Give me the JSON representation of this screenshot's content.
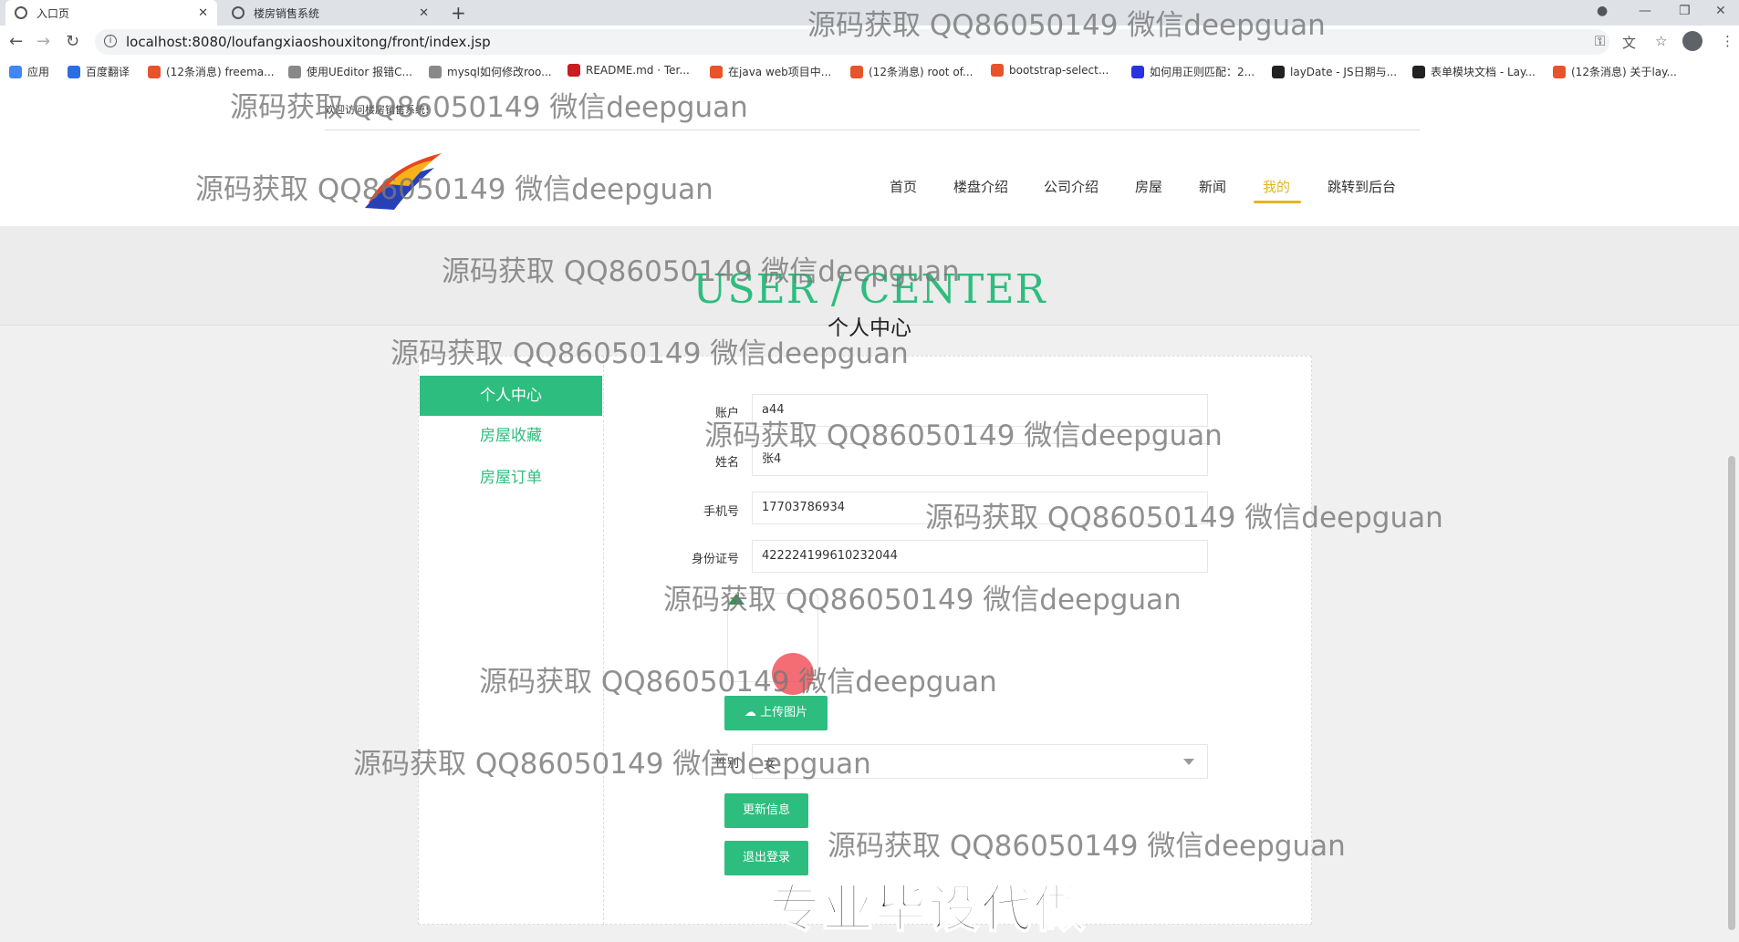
{
  "browser": {
    "tabs": [
      {
        "title": "入口页",
        "active": true
      },
      {
        "title": "楼房销售系统",
        "active": false
      }
    ],
    "url": "localhost:8080/loufangxiaoshouxitong/front/index.jsp",
    "bookmarks": [
      {
        "label": "应用",
        "color": "#4285f4"
      },
      {
        "label": "百度翻译",
        "color": "#2b6de5"
      },
      {
        "label": "(12条消息) freema...",
        "color": "#e8532b"
      },
      {
        "label": "使用UEditor 报错C...",
        "color": "#666666"
      },
      {
        "label": "mysql如何修改roo...",
        "color": "#666666"
      },
      {
        "label": "README.md · Ter...",
        "color": "#c71d23"
      },
      {
        "label": "在java web项目中...",
        "color": "#e8532b"
      },
      {
        "label": "(12条消息) root of...",
        "color": "#e8532b"
      },
      {
        "label": "bootstrap-select...",
        "color": "#e8532b"
      },
      {
        "label": "如何用正则匹配：2...",
        "color": "#2932e1"
      },
      {
        "label": "layDate - JS日期与...",
        "color": "#222222"
      },
      {
        "label": "表单模块文档 - Lay...",
        "color": "#222222"
      },
      {
        "label": "(12条消息) 关于lay...",
        "color": "#e8532b"
      }
    ]
  },
  "site": {
    "welcome": "欢迎访问楼房销售系统!",
    "nav": [
      "首页",
      "楼盘介绍",
      "公司介绍",
      "房屋",
      "新闻",
      "我的",
      "跳转到后台"
    ],
    "nav_active": "我的",
    "accent": "#2dbd7e",
    "nav_accent": "#e6b422"
  },
  "banner": {
    "en": "USER / CENTER",
    "cn": "个人中心"
  },
  "sidebar": {
    "items": [
      "个人中心",
      "房屋收藏",
      "房屋订单"
    ],
    "active": "个人中心"
  },
  "form": {
    "account_label": "账户",
    "account_value": "a44",
    "name_label": "姓名",
    "name_value": "张4",
    "phone_label": "手机号",
    "phone_value": "17703786934",
    "idcard_label": "身份证号",
    "idcard_value": "422224199610232044",
    "upload_label": "上传图片",
    "gender_label": "性别",
    "gender_value": "女",
    "update_label": "更新信息",
    "logout_label": "退出登录"
  },
  "watermark": "源码获取 QQ86050149 微信deepguan",
  "ad_text": "专业毕设代做"
}
